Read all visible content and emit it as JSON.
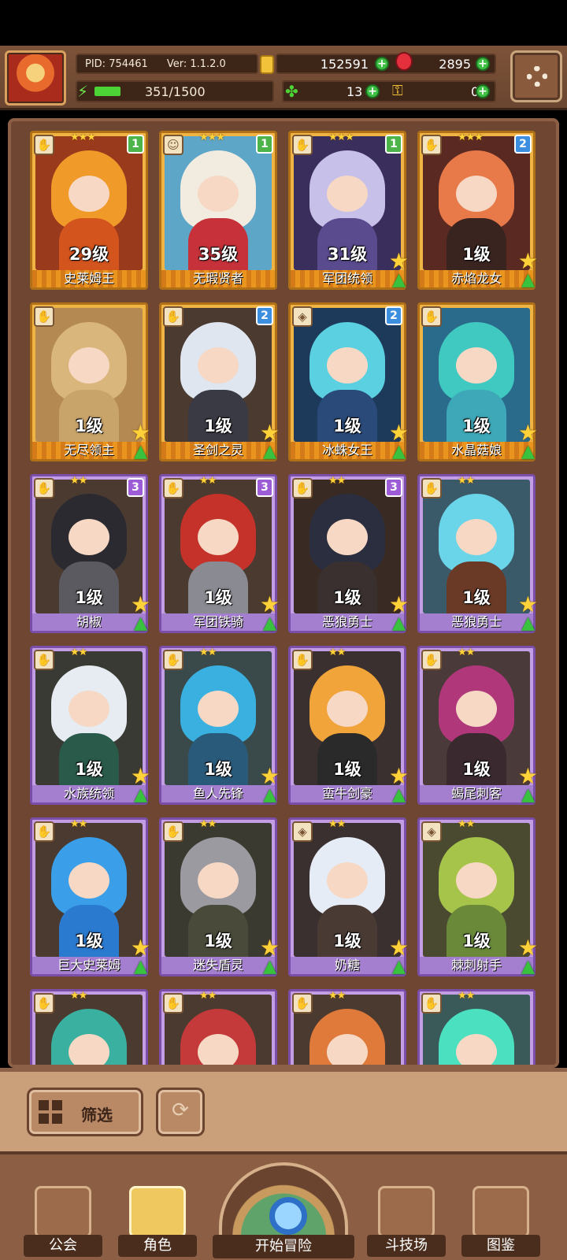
{
  "header": {
    "pid": "PID: 754461",
    "version": "Ver: 1.1.2.0",
    "gold": "152591",
    "gems": "2895",
    "exp": "351/1500",
    "exp_progress": 0.234,
    "clover": "13",
    "keys": "0"
  },
  "cards": [
    {
      "name": "史莱姆王",
      "level": "29级",
      "rarity": "gold",
      "badge": "1",
      "badge_color": "g",
      "stars": "★★★",
      "hair": "#f09a2a",
      "body": "#d4541e",
      "bg": "#9a3a1c",
      "type": "✋",
      "upgrade": false
    },
    {
      "name": "无瑕贤者",
      "level": "35级",
      "rarity": "gold",
      "badge": "1",
      "badge_color": "g",
      "stars": "★★★",
      "hair": "#f2ece0",
      "body": "#c7323a",
      "bg": "#5ea6c8",
      "type": "☺",
      "upgrade": false
    },
    {
      "name": "军团统领",
      "level": "31级",
      "rarity": "gold",
      "badge": "1",
      "badge_color": "g",
      "stars": "★★★",
      "hair": "#c7c0e8",
      "body": "#5a4a8e",
      "bg": "#3a2f5c",
      "type": "✋",
      "upgrade": true
    },
    {
      "name": "赤焰龙女",
      "level": "1级",
      "rarity": "gold",
      "badge": "2",
      "badge_color": "b",
      "stars": "★★★",
      "hair": "#e87a4a",
      "body": "#3a2420",
      "bg": "#5a2a22",
      "type": "✋",
      "upgrade": true
    },
    {
      "name": "无尽领主",
      "level": "1级",
      "rarity": "gold",
      "badge": "",
      "badge_color": "",
      "stars": "",
      "hair": "#d9b67c",
      "body": "#c9a46a",
      "bg": "#b48a52",
      "type": "✋",
      "upgrade": true
    },
    {
      "name": "圣剑之灵",
      "level": "1级",
      "rarity": "gold",
      "badge": "2",
      "badge_color": "b",
      "stars": "",
      "hair": "#dfe6f0",
      "body": "#3a3a44",
      "bg": "#4a3a30",
      "type": "✋",
      "upgrade": true
    },
    {
      "name": "冰蛛女王",
      "level": "1级",
      "rarity": "gold",
      "badge": "2",
      "badge_color": "b",
      "stars": "",
      "hair": "#5ad0e0",
      "body": "#2a4a7a",
      "bg": "#1e3a5a",
      "type": "◈",
      "upgrade": true
    },
    {
      "name": "水晶菇娘",
      "level": "1级",
      "rarity": "gold",
      "badge": "",
      "badge_color": "",
      "stars": "",
      "hair": "#40c9c0",
      "body": "#3ea8b8",
      "bg": "#2a6a8a",
      "type": "✋",
      "upgrade": true
    },
    {
      "name": "胡椒",
      "level": "1级",
      "rarity": "purple",
      "badge": "3",
      "badge_color": "p",
      "stars": "★★",
      "hair": "#2a2a30",
      "body": "#5a5a60",
      "bg": "#4a3a30",
      "type": "✋",
      "upgrade": true
    },
    {
      "name": "军团铁骑",
      "level": "1级",
      "rarity": "purple",
      "badge": "3",
      "badge_color": "p",
      "stars": "★★",
      "hair": "#c4322a",
      "body": "#8a8a92",
      "bg": "#4a3a30",
      "type": "✋",
      "upgrade": true
    },
    {
      "name": "恶狼勇士",
      "level": "1级",
      "rarity": "purple",
      "badge": "3",
      "badge_color": "p",
      "stars": "★★",
      "hair": "#2a2e3e",
      "body": "#3a3030",
      "bg": "#3a2a24",
      "type": "✋",
      "upgrade": true
    },
    {
      "name": "恶狼勇士",
      "level": "1级",
      "rarity": "purple",
      "badge": "",
      "badge_color": "",
      "stars": "★★",
      "hair": "#6ad4e8",
      "body": "#6a3a26",
      "bg": "#3a5a6a",
      "type": "✋",
      "upgrade": true
    },
    {
      "name": "水族统领",
      "level": "1级",
      "rarity": "purple",
      "badge": "",
      "badge_color": "",
      "stars": "★★",
      "hair": "#e6ecf2",
      "body": "#2a5a4a",
      "bg": "#3a3a34",
      "type": "✋",
      "upgrade": true
    },
    {
      "name": "鱼人先锋",
      "level": "1级",
      "rarity": "purple",
      "badge": "",
      "badge_color": "",
      "stars": "★★",
      "hair": "#3ab0e0",
      "body": "#2a5a7a",
      "bg": "#3a4a4a",
      "type": "✋",
      "upgrade": true
    },
    {
      "name": "蛮牛剑豪",
      "level": "1级",
      "rarity": "purple",
      "badge": "",
      "badge_color": "",
      "stars": "★★",
      "hair": "#f0a43a",
      "body": "#2a2a2a",
      "bg": "#3a3030",
      "type": "✋",
      "upgrade": true
    },
    {
      "name": "蝎尾刺客",
      "level": "1级",
      "rarity": "purple",
      "badge": "",
      "badge_color": "",
      "stars": "★★",
      "hair": "#b0387a",
      "body": "#3a2a30",
      "bg": "#4a3a3a",
      "type": "✋",
      "upgrade": true
    },
    {
      "name": "巨大史莱姆",
      "level": "1级",
      "rarity": "purple",
      "badge": "",
      "badge_color": "",
      "stars": "★★",
      "hair": "#3a9ee8",
      "body": "#2a7ad0",
      "bg": "#4a3a30",
      "type": "✋",
      "upgrade": true
    },
    {
      "name": "迷失盾灵",
      "level": "1级",
      "rarity": "purple",
      "badge": "",
      "badge_color": "",
      "stars": "★★",
      "hair": "#9a9aa0",
      "body": "#4a4a3a",
      "bg": "#3a3a30",
      "type": "✋",
      "upgrade": true
    },
    {
      "name": "奶糖",
      "level": "1级",
      "rarity": "purple",
      "badge": "",
      "badge_color": "",
      "stars": "★★",
      "hair": "#e6ecf6",
      "body": "#4a3a34",
      "bg": "#3a3030",
      "type": "◈",
      "upgrade": true
    },
    {
      "name": "棘刺射手",
      "level": "1级",
      "rarity": "purple",
      "badge": "",
      "badge_color": "",
      "stars": "★★",
      "hair": "#a6c44a",
      "body": "#6a8a3a",
      "bg": "#4a4a30",
      "type": "◈",
      "upgrade": true
    },
    {
      "name": "",
      "level": "",
      "rarity": "purple",
      "badge": "",
      "badge_color": "",
      "stars": "★★",
      "hair": "#3ab0a0",
      "body": "#2a6a6a",
      "bg": "#4a3a30",
      "type": "✋",
      "upgrade": false
    },
    {
      "name": "",
      "level": "",
      "rarity": "purple",
      "badge": "",
      "badge_color": "",
      "stars": "★★",
      "hair": "#c43a3a",
      "body": "#3a2a5a",
      "bg": "#4a3a30",
      "type": "✋",
      "upgrade": false
    },
    {
      "name": "",
      "level": "",
      "rarity": "purple",
      "badge": "",
      "badge_color": "",
      "stars": "★★",
      "hair": "#e07a3a",
      "body": "#8a4a2a",
      "bg": "#4a3a30",
      "type": "✋",
      "upgrade": false
    },
    {
      "name": "",
      "level": "",
      "rarity": "purple",
      "badge": "",
      "badge_color": "",
      "stars": "★★",
      "hair": "#4ae0c0",
      "body": "#2a8a7a",
      "bg": "#3a5a5a",
      "type": "✋",
      "upgrade": false
    }
  ],
  "filter": {
    "label": "筛选"
  },
  "nav": {
    "guild": "公会",
    "characters": "角色",
    "adventure": "开始冒险",
    "arena": "斗技场",
    "codex": "图鉴"
  },
  "colors": {
    "accent_gold": "#f0b445",
    "accent_purple": "#c39ee5",
    "panel": "#6e4632"
  }
}
